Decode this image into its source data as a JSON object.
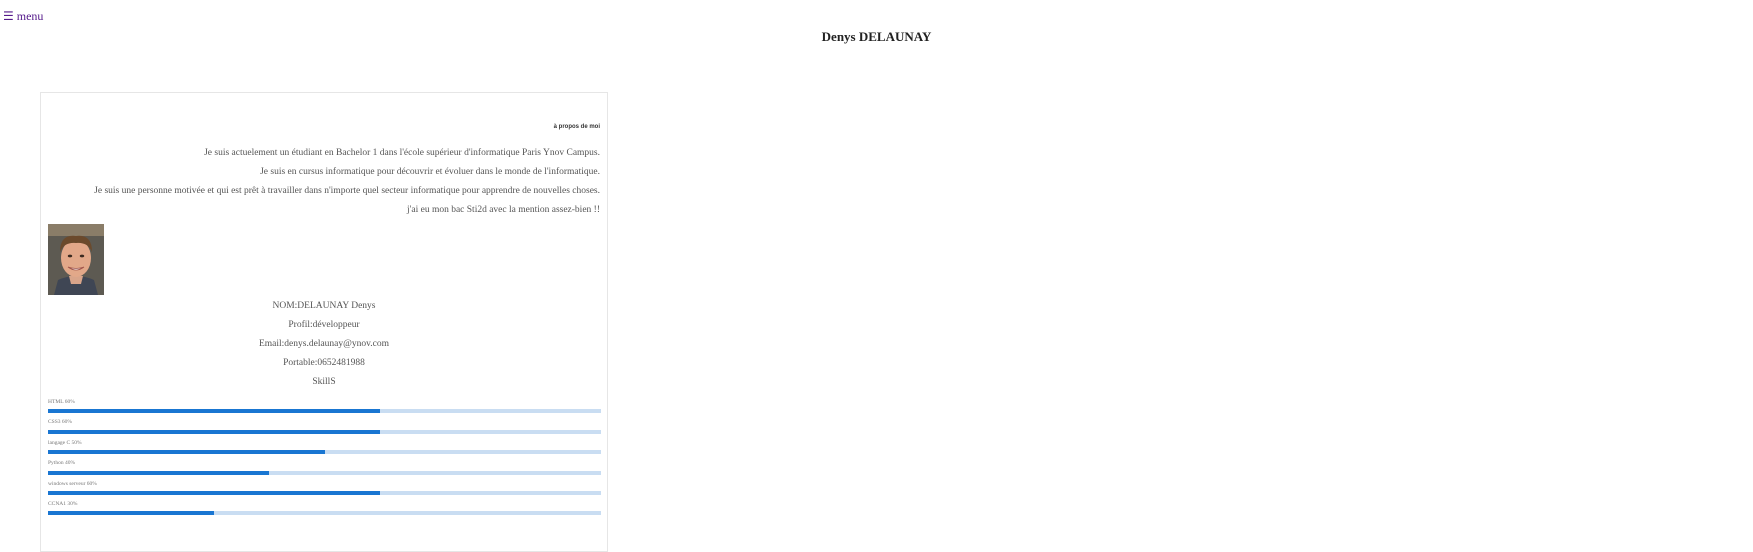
{
  "header": {
    "menu_icon": "☰",
    "menu_label": "menu",
    "title": "Denys DELAUNAY"
  },
  "about": {
    "heading": "à propos de moi",
    "lines": [
      "Je suis actuelement un étudiant en Bachelor 1 dans l'école supérieur d'informatique Paris Ynov Campus.",
      "Je suis en cursus informatique pour découvrir et évoluer dans le monde de l'informatique.",
      "Je suis une personne motivée et qui est prêt à travailler dans n'importe quel secteur informatique pour apprendre de nouvelles choses.",
      "j'ai eu mon bac Sti2d avec la mention assez-bien !!"
    ]
  },
  "profile": {
    "name": "NOM:DELAUNAY Denys",
    "role": "Profil:développeur",
    "email": "Email:denys.delaunay@ynov.com",
    "phone": "Portable:0652481988",
    "skills_heading": "SkillS"
  },
  "skills": [
    {
      "label": "HTML 60%",
      "percent": 60
    },
    {
      "label": "CSS3 60%",
      "percent": 60
    },
    {
      "label": "langage C 50%",
      "percent": 50
    },
    {
      "label": "Python 40%",
      "percent": 40
    },
    {
      "label": "windows serveur 60%",
      "percent": 60
    },
    {
      "label": "CCNA1 30%",
      "percent": 30
    }
  ],
  "colors": {
    "accent": "#1976d2",
    "track": "#c9ddf2",
    "link": "#551a8b"
  }
}
